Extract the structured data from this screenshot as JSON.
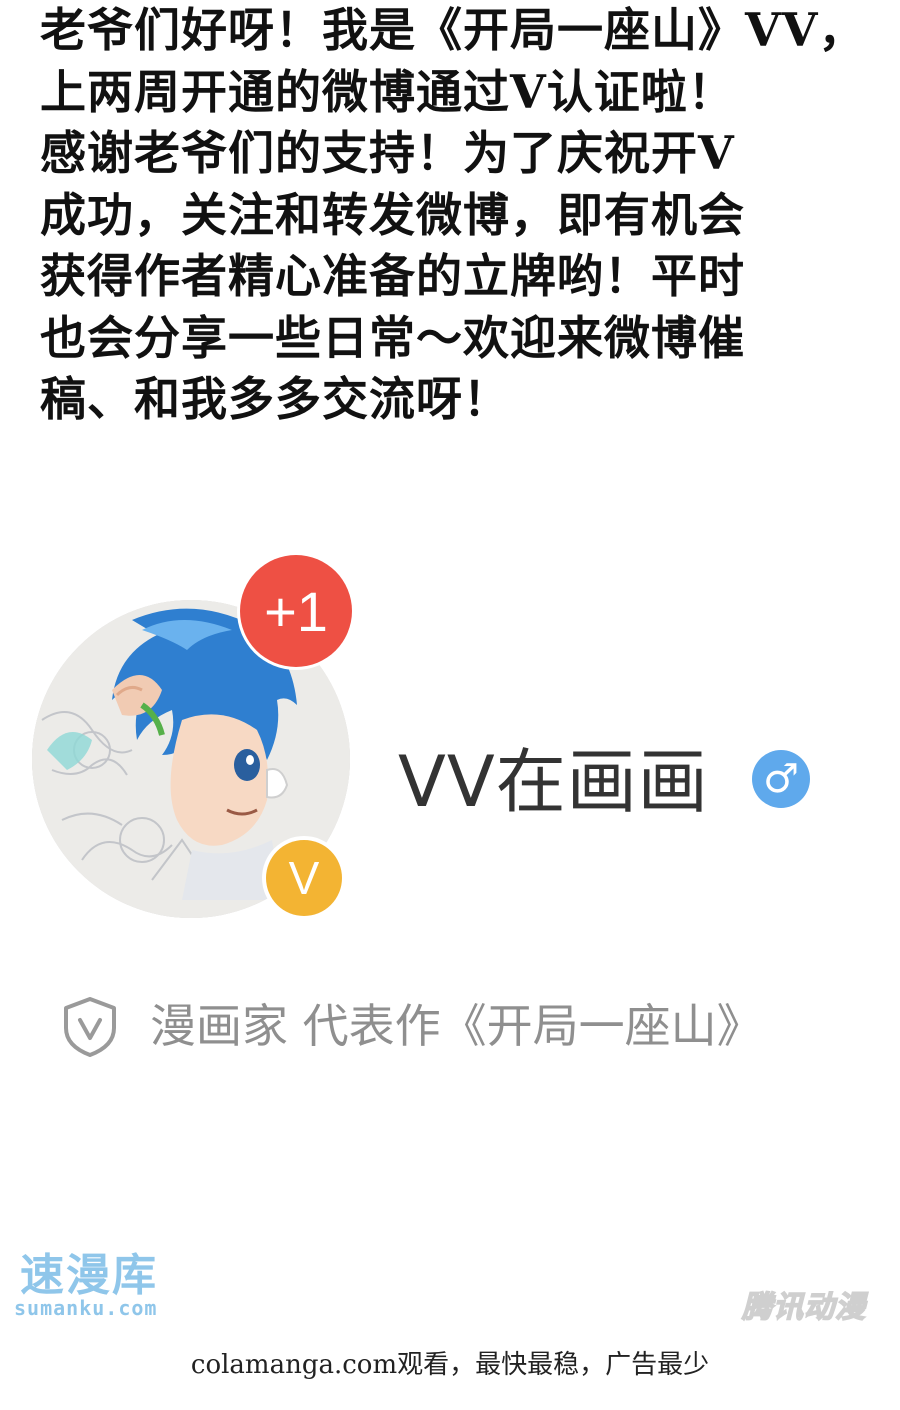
{
  "announcement": {
    "lines": [
      "老爷们好呀！我是《开局一座山》VV，",
      "上两周开通的微博通过V认证啦！",
      "感谢老爷们的支持！为了庆祝开V",
      "成功，关注和转发微博，即有机会",
      "获得作者精心准备的立牌哟！平时",
      "也会分享一些日常～欢迎来微博催",
      "稿、和我多多交流呀！"
    ]
  },
  "profile": {
    "notification_badge": "+1",
    "verified_badge": "V",
    "username": "VV在画画",
    "gender_symbol": "♂",
    "certification": "漫画家 代表作《开局一座山》"
  },
  "watermarks": {
    "left_title": "速漫库",
    "left_subtitle": "sumanku.com",
    "right": "腾讯动漫"
  },
  "footer": {
    "note": "colamanga.com观看，最快最稳，广告最少"
  },
  "colors": {
    "notification_badge": "#ee5044",
    "verified_badge": "#f3b433",
    "gender_icon": "#5fa9ec",
    "watermark": "#8fc6ea"
  }
}
